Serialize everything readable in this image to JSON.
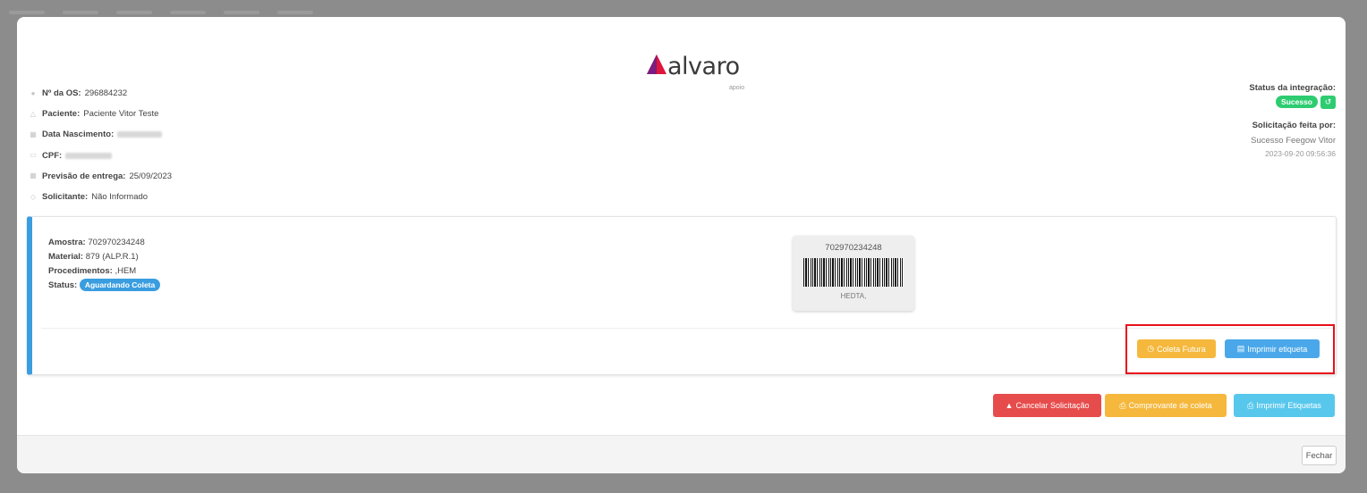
{
  "logo": {
    "brand": "alvaro",
    "sub": "apoio"
  },
  "order_info": [
    {
      "icon": "circle-icon",
      "label": "Nº da OS:",
      "value": "296884232",
      "redacted": false
    },
    {
      "icon": "user-icon",
      "label": "Paciente:",
      "value": "Paciente Vitor Teste",
      "redacted": false
    },
    {
      "icon": "cake-icon",
      "label": "Data Nascimento:",
      "value": "",
      "redacted": true
    },
    {
      "icon": "id-card-icon",
      "label": "CPF:",
      "value": "",
      "redacted": true
    },
    {
      "icon": "calendar-icon",
      "label": "Previsão de entrega:",
      "value": "25/09/2023",
      "redacted": false
    },
    {
      "icon": "tag-icon",
      "label": "Solicitante:",
      "value": "Não Informado",
      "redacted": false
    }
  ],
  "integration": {
    "status_label": "Status da integração:",
    "status_value": "Sucesso",
    "status_color": "#2ecc71",
    "requested_by_label": "Solicitação feita por:",
    "requested_by_name": "Sucesso Feegow Vitor",
    "requested_at": "2023-09-20 09:56:36"
  },
  "sample": {
    "amostra_label": "Amostra:",
    "amostra": "702970234248",
    "material_label": "Material:",
    "material": "879 (ALP.R.1)",
    "procedimentos_label": "Procedimentos:",
    "procedimentos": ",HEM",
    "status_label": "Status:",
    "status": "Aguardando Coleta",
    "status_color": "#3a9de0",
    "barcode_number": "702970234248",
    "barcode_sub": "HEDTA,"
  },
  "card_actions": {
    "coleta_futura": "Coleta Futura",
    "imprimir_etiqueta": "Imprimir etiqueta"
  },
  "actions": {
    "cancelar": "Cancelar Solicitação",
    "comprovante": "Comprovante de coleta",
    "imprimir_etiquetas": "Imprimir Etiquetas"
  },
  "footer": {
    "close": "Fechar"
  },
  "colors": {
    "danger": "#e74c4c",
    "warning": "#f5b83d",
    "primary": "#4aa8ea",
    "info": "#57c7ec",
    "highlight": "#e8101a"
  }
}
